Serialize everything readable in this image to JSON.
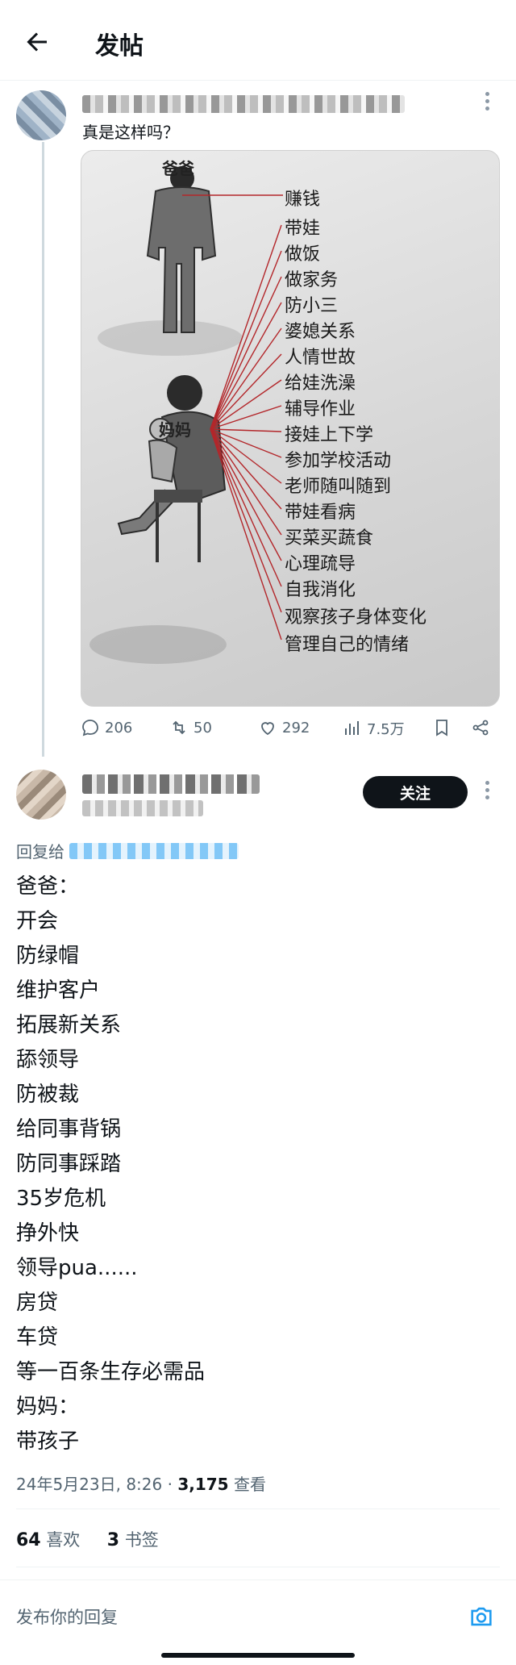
{
  "header": {
    "title": "发帖"
  },
  "post": {
    "text": "真是这样吗？",
    "image": {
      "father_label": "爸爸",
      "mother_label": "妈妈",
      "items": [
        "赚钱",
        "带娃",
        "做饭",
        "做家务",
        "防小三",
        "婆媳关系",
        "人情世故",
        "给娃洗澡",
        "辅导作业",
        "接娃上下学",
        "参加学校活动",
        "老师随叫随到",
        "带娃看病",
        "买菜买蔬食",
        "心理疏导",
        "自我消化",
        "观察孩子身体变化",
        "管理自己的情绪"
      ]
    },
    "stats": {
      "replies": "206",
      "reposts": "50",
      "likes": "292",
      "views": "7.5万"
    }
  },
  "reply": {
    "follow_label": "关注",
    "reply_to_prefix": "回复给",
    "lines": [
      "爸爸：",
      "开会",
      "防绿帽",
      "维护客户",
      "拓展新关系",
      "舔领导",
      "防被裁",
      "给同事背锅",
      "防同事踩踏",
      "35岁危机",
      "挣外快",
      "领导pua......",
      "房贷",
      "车贷",
      "等一百条生存必需品",
      "妈妈：",
      "带孩子"
    ],
    "timestamp": "24年5月23日, 8:26 · ",
    "views_count": "3,175",
    "views_label": " 查看",
    "likes_count": "64",
    "likes_label": " 喜欢",
    "bookmarks_count": "3",
    "bookmarks_label": " 书签"
  },
  "composer": {
    "placeholder": "发布你的回复"
  },
  "colors": {
    "accent": "#1d9bf0",
    "text": "#0f1419",
    "muted": "#536471",
    "string_red": "#b3262a"
  }
}
